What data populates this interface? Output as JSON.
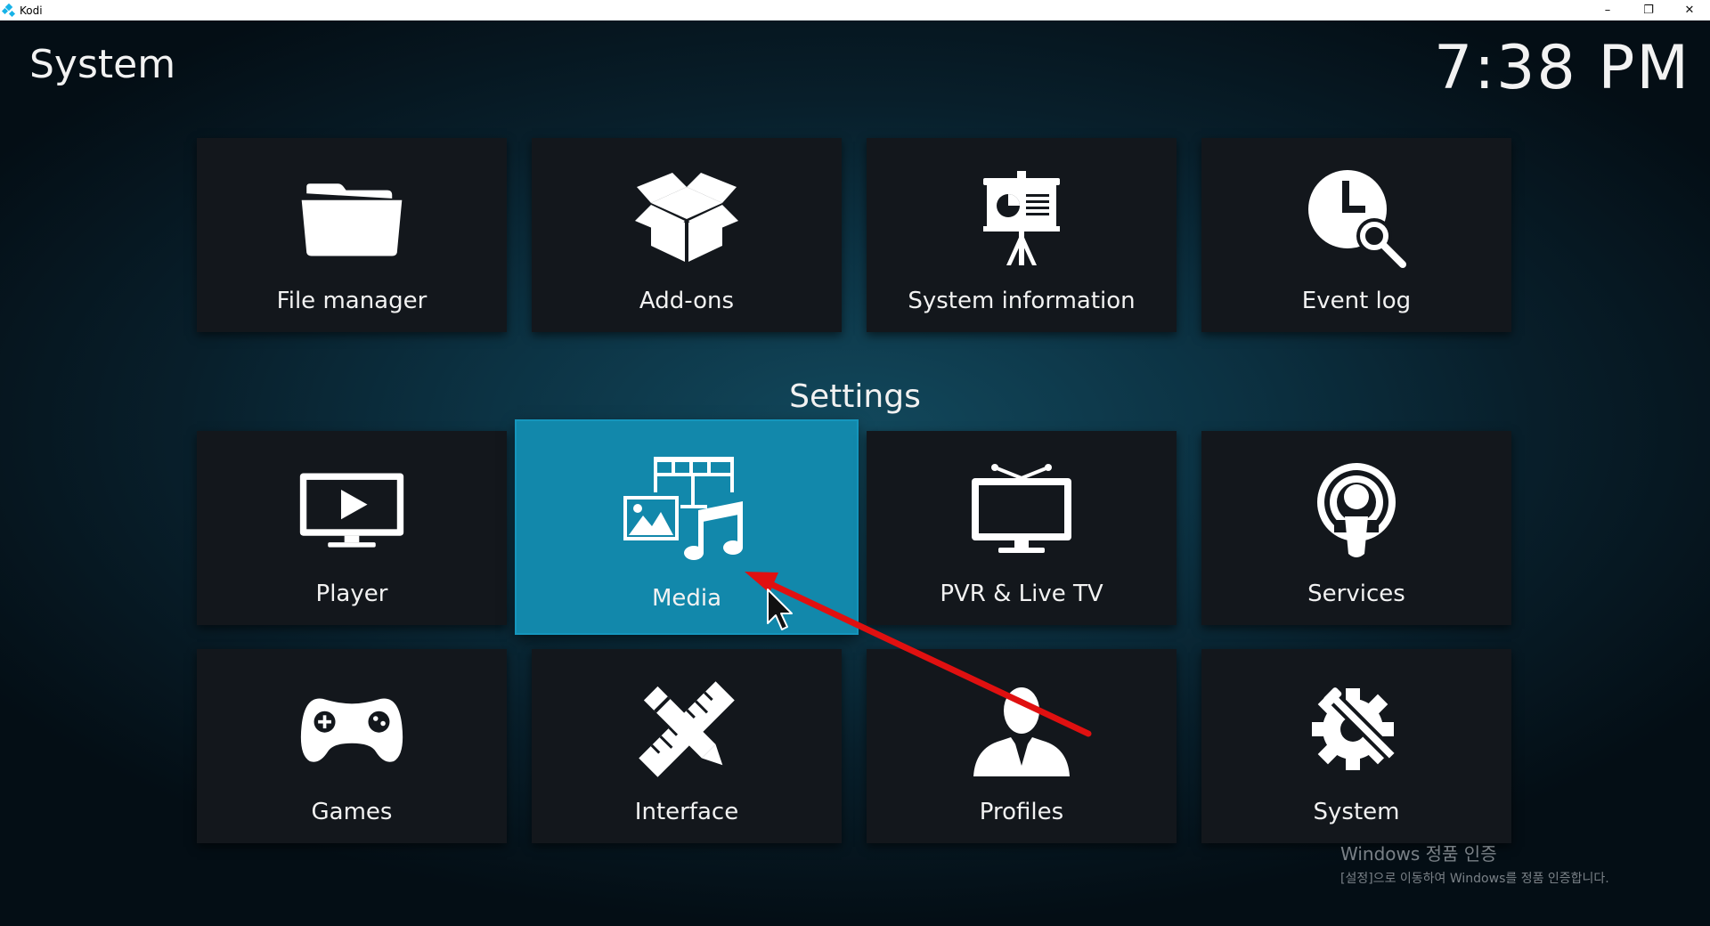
{
  "window": {
    "title": "Kodi",
    "controls": {
      "minimize": "–",
      "restore": "❐",
      "close": "✕"
    }
  },
  "header": {
    "title": "System",
    "clock": "7:38 PM"
  },
  "top_tiles": [
    {
      "label": "File manager",
      "icon": "folder-icon"
    },
    {
      "label": "Add-ons",
      "icon": "open-box-icon"
    },
    {
      "label": "System information",
      "icon": "presentation-easel-icon"
    },
    {
      "label": "Event log",
      "icon": "clock-search-icon"
    }
  ],
  "settings": {
    "title": "Settings",
    "tiles": [
      {
        "label": "Player",
        "icon": "monitor-play-icon"
      },
      {
        "label": "Media",
        "icon": "media-library-icon",
        "focused": true
      },
      {
        "label": "PVR & Live TV",
        "icon": "tv-antenna-icon"
      },
      {
        "label": "Services",
        "icon": "broadcast-icon"
      },
      {
        "label": "Games",
        "icon": "gamepad-icon"
      },
      {
        "label": "Interface",
        "icon": "pencil-ruler-icon"
      },
      {
        "label": "Profiles",
        "icon": "user-silhouette-icon"
      },
      {
        "label": "System",
        "icon": "gear-wrench-icon"
      }
    ]
  },
  "watermark": {
    "line1": "Windows 정품 인증",
    "line2": "[설정]으로 이동하여 Windows를 정품 인증합니다."
  },
  "colors": {
    "accent": "#1288ab",
    "tile_bg": "#13171c",
    "annotation_arrow": "#e01010"
  }
}
